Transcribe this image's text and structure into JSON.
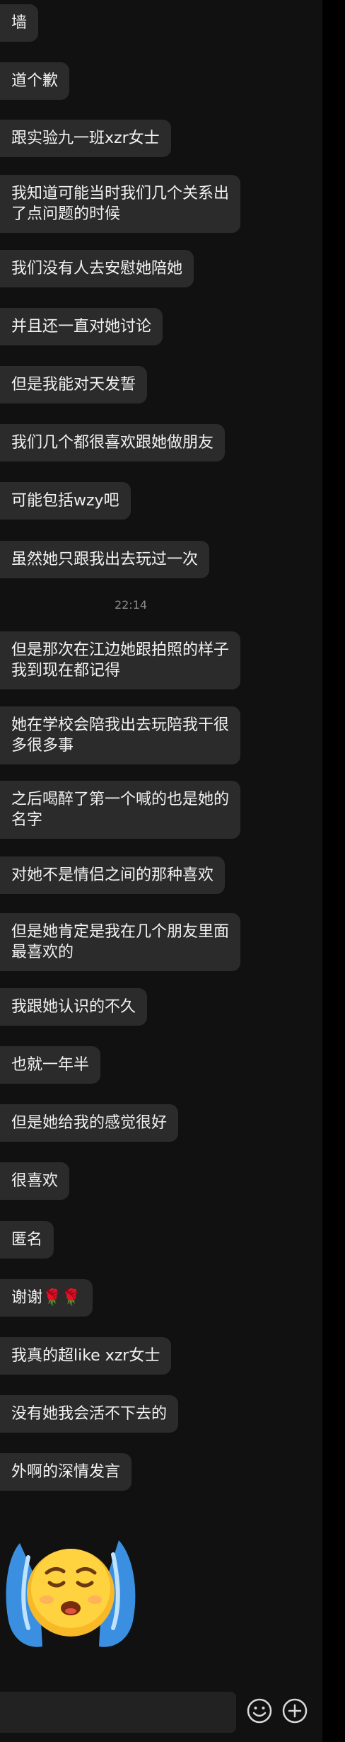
{
  "messages": [
    "墙",
    "道个歉",
    "跟实验九一班xzr女士",
    "我知道可能当时我们几个关系出\n了点问题的时候",
    "我们没有人去安慰她陪她",
    "并且还一直对她讨论",
    "但是我能对天发誓",
    "我们几个都很喜欢跟她做朋友",
    "可能包括wzy吧",
    "虽然她只跟我出去玩过一次"
  ],
  "timestamp": "22:14",
  "messages_after": [
    "但是那次在江边她跟拍照的样子\n我到现在都记得",
    "她在学校会陪我出去玩陪我干很\n多很多事",
    "之后喝醉了第一个喊的也是她的\n名字",
    "对她不是情侣之间的那种喜欢",
    "但是她肯定是我在几个朋友里面\n最喜欢的",
    "我跟她认识的不久",
    "也就一年半",
    "但是她给我的感觉很好",
    "很喜欢",
    "匿名",
    "谢谢🌹🌹",
    "我真的超like xzr女士",
    "没有她我会活不下去的",
    "外啊的深情发言"
  ],
  "sticker": {
    "icon": "crying-emoji-sticker"
  },
  "bottom_bar": {
    "emoji_icon": "smiley-icon",
    "add_icon": "plus-icon"
  },
  "colors": {
    "bubble": "#2b2b2b",
    "background": "#111111",
    "text": "#f2f2f2"
  }
}
